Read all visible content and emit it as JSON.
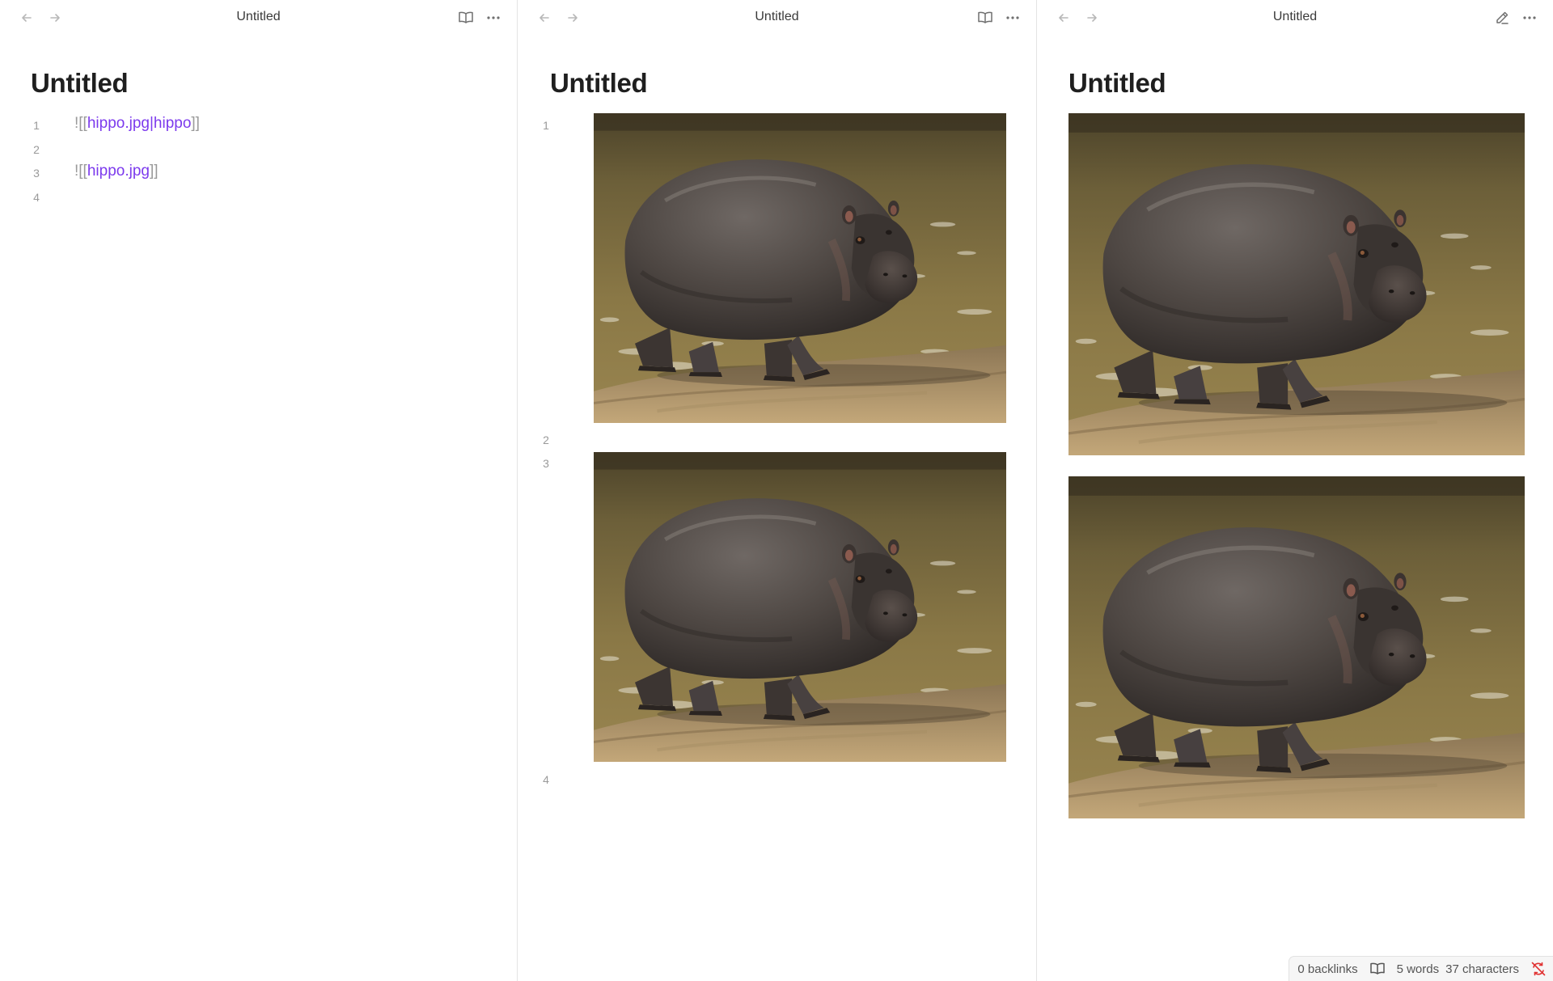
{
  "panes": [
    {
      "header_title": "Untitled",
      "doc_title": "Untitled",
      "actions": [
        "book-open-icon",
        "more-horizontal-icon"
      ],
      "lines": [
        {
          "num": "1",
          "open": "![[",
          "link": "hippo.jpg|hippo",
          "close": "]]"
        },
        {
          "num": "2"
        },
        {
          "num": "3",
          "open": "![[",
          "link": "hippo.jpg",
          "close": "]]"
        },
        {
          "num": "4"
        }
      ]
    },
    {
      "header_title": "Untitled",
      "doc_title": "Untitled",
      "actions": [
        "book-open-icon",
        "more-horizontal-icon"
      ],
      "line_numbers": [
        "1",
        "2",
        "3",
        "4"
      ],
      "images": [
        {
          "alt": "hippo"
        },
        {
          "alt": "hippo.jpg"
        }
      ]
    },
    {
      "header_title": "Untitled",
      "doc_title": "Untitled",
      "actions": [
        "pencil-icon",
        "more-horizontal-icon"
      ],
      "images": [
        {
          "alt": "hippo"
        },
        {
          "alt": "hippo.jpg"
        }
      ]
    }
  ],
  "status": {
    "backlinks": "0 backlinks",
    "words": "5 words",
    "characters": "37 characters"
  },
  "colors": {
    "link": "#7c3aed",
    "sync_icon": "#e03131"
  }
}
